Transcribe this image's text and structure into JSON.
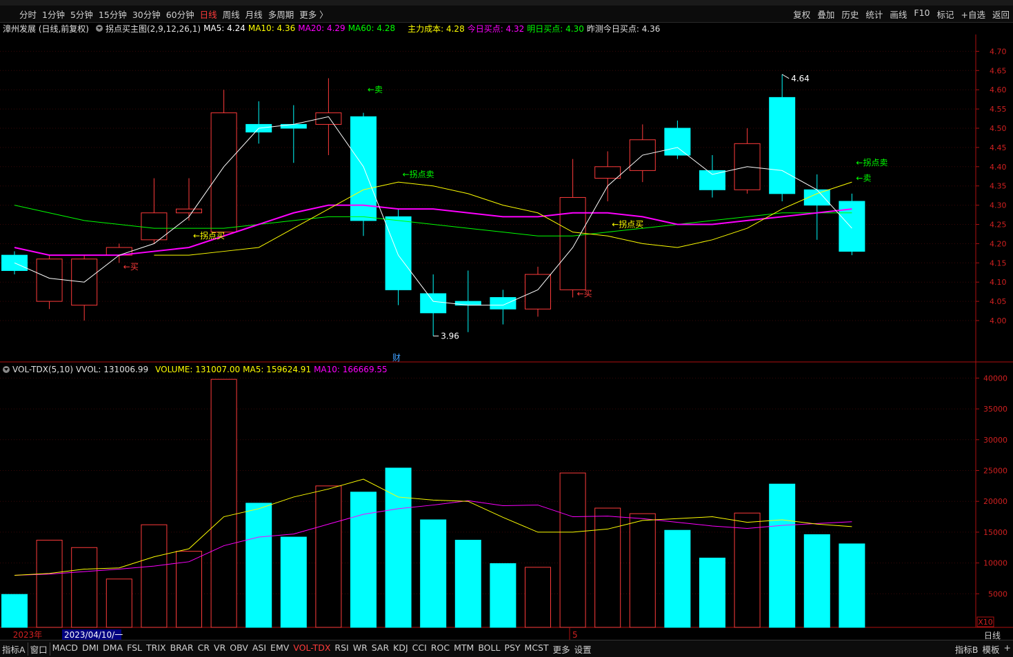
{
  "toolbar": {
    "periods": [
      "分时",
      "1分钟",
      "5分钟",
      "15分钟",
      "30分钟",
      "60分钟",
      "日线",
      "周线",
      "月线",
      "多周期",
      "更多 〉"
    ],
    "active_period": "日线",
    "actions": [
      "复权",
      "叠加",
      "历史",
      "统计",
      "画线",
      "F10",
      "标记",
      "+自选",
      "返回"
    ]
  },
  "main_indicator": {
    "stock": "漳州发展 (日线,前复权)",
    "formula": "拐点买主图(2,9,12,26,1)",
    "ma5": "MA5: 4.24",
    "ma10": "MA10: 4.36",
    "ma20": "MA20: 4.29",
    "ma60": "MA60: 4.28",
    "cost": "主力成本: 4.28",
    "today_buy": "今日买点: 4.32",
    "tomorrow_buy": "明日买点: 4.30",
    "yest_pred": "昨测今日买点: 4.36"
  },
  "vol_indicator": {
    "name": "VOL-TDX(5,10)",
    "vvol": "VVOL: 131006.99",
    "volume": "VOLUME: 131007.00",
    "ma5": "MA5: 159624.91",
    "ma10": "MA10: 166669.55"
  },
  "colors": {
    "up": "#ff3b3b",
    "down": "#00ffff",
    "ma5": "#ffffff",
    "ma10": "#ffff00",
    "ma20": "#ff00ff",
    "ma60": "#00ff00",
    "buy": "#ffff00",
    "sell": "#00ff00"
  },
  "chart_data": [
    {
      "type": "candlestick",
      "ylim": [
        4.0,
        4.7
      ],
      "y_ticks": [
        "4.70",
        "4.65",
        "4.60",
        "4.55",
        "4.50",
        "4.45",
        "4.40",
        "4.35",
        "4.30",
        "4.25",
        "4.20",
        "4.15",
        "4.10",
        "4.05",
        "4.00"
      ],
      "candles": [
        {
          "o": 4.17,
          "c": 4.13,
          "h": 4.18,
          "l": 4.12
        },
        {
          "o": 4.05,
          "c": 4.16,
          "h": 4.17,
          "l": 4.03
        },
        {
          "o": 4.04,
          "c": 4.16,
          "h": 4.17,
          "l": 4.0
        },
        {
          "o": 4.17,
          "c": 4.19,
          "h": 4.2,
          "l": 4.15
        },
        {
          "o": 4.21,
          "c": 4.28,
          "h": 4.37,
          "l": 4.2
        },
        {
          "o": 4.28,
          "c": 4.29,
          "h": 4.37,
          "l": 4.26
        },
        {
          "o": 4.23,
          "c": 4.54,
          "h": 4.6,
          "l": 4.22
        },
        {
          "o": 4.51,
          "c": 4.49,
          "h": 4.57,
          "l": 4.46
        },
        {
          "o": 4.51,
          "c": 4.5,
          "h": 4.56,
          "l": 4.41
        },
        {
          "o": 4.51,
          "c": 4.54,
          "h": 4.63,
          "l": 4.43
        },
        {
          "o": 4.53,
          "c": 4.26,
          "h": 4.54,
          "l": 4.22
        },
        {
          "o": 4.27,
          "c": 4.08,
          "h": 4.29,
          "l": 4.04
        },
        {
          "o": 4.07,
          "c": 4.02,
          "h": 4.12,
          "l": 3.96
        },
        {
          "o": 4.05,
          "c": 4.04,
          "h": 4.13,
          "l": 3.97
        },
        {
          "o": 4.06,
          "c": 4.03,
          "h": 4.08,
          "l": 3.99
        },
        {
          "o": 4.03,
          "c": 4.12,
          "h": 4.14,
          "l": 4.01
        },
        {
          "o": 4.08,
          "c": 4.32,
          "h": 4.42,
          "l": 4.06
        },
        {
          "o": 4.37,
          "c": 4.4,
          "h": 4.44,
          "l": 4.31
        },
        {
          "o": 4.39,
          "c": 4.47,
          "h": 4.51,
          "l": 4.36
        },
        {
          "o": 4.5,
          "c": 4.43,
          "h": 4.52,
          "l": 4.42
        },
        {
          "o": 4.39,
          "c": 4.34,
          "h": 4.43,
          "l": 4.32
        },
        {
          "o": 4.34,
          "c": 4.46,
          "h": 4.5,
          "l": 4.33
        },
        {
          "o": 4.58,
          "c": 4.33,
          "h": 4.64,
          "l": 4.31
        },
        {
          "o": 4.34,
          "c": 4.3,
          "h": 4.38,
          "l": 4.21
        },
        {
          "o": 4.31,
          "c": 4.18,
          "h": 4.33,
          "l": 4.17
        }
      ],
      "ma5": [
        4.15,
        4.11,
        4.1,
        4.17,
        4.2,
        4.27,
        4.4,
        4.5,
        4.51,
        4.53,
        4.4,
        4.17,
        4.05,
        4.04,
        4.04,
        4.08,
        4.19,
        4.35,
        4.43,
        4.45,
        4.38,
        4.4,
        4.39,
        4.34,
        4.24
      ],
      "ma10": [
        4.17,
        4.17,
        4.18,
        4.19,
        4.24,
        4.29,
        4.34,
        4.36,
        4.35,
        4.33,
        4.3,
        4.28,
        4.23,
        4.22,
        4.2,
        4.19,
        4.21,
        4.24,
        4.29,
        4.33,
        4.36
      ],
      "ma20": [
        4.19,
        4.17,
        4.17,
        4.17,
        4.18,
        4.19,
        4.22,
        4.25,
        4.28,
        4.3,
        4.3,
        4.29,
        4.29,
        4.28,
        4.27,
        4.27,
        4.28,
        4.28,
        4.27,
        4.25,
        4.25,
        4.26,
        4.27,
        4.28,
        4.29
      ],
      "ma60": [
        4.3,
        4.28,
        4.26,
        4.25,
        4.24,
        4.24,
        4.24,
        4.25,
        4.26,
        4.27,
        4.27,
        4.26,
        4.25,
        4.24,
        4.23,
        4.22,
        4.22,
        4.23,
        4.24,
        4.25,
        4.26,
        4.27,
        4.28,
        4.28,
        4.28
      ],
      "annotations": [
        {
          "text": "←卖",
          "type": "sell",
          "candle": 10,
          "price": 4.6
        },
        {
          "text": "←拐点卖",
          "type": "sell",
          "candle": 11,
          "price": 4.38
        },
        {
          "text": "←拐点买",
          "type": "buy",
          "candle": 5,
          "price": 4.22
        },
        {
          "text": "←买",
          "type": "buyred",
          "candle": 3,
          "price": 4.14
        },
        {
          "text": "←拐点买",
          "type": "buy",
          "candle": 17,
          "price": 4.25
        },
        {
          "text": "←买",
          "type": "buyred",
          "candle": 16,
          "price": 4.07
        },
        {
          "text": "←拐点卖",
          "type": "sell",
          "candle": 24,
          "price": 4.41
        },
        {
          "text": "←卖",
          "type": "sell",
          "candle": 24,
          "price": 4.37
        }
      ],
      "extremes": {
        "high": "4.64",
        "low": "3.96"
      },
      "finance_marker": "财"
    },
    {
      "type": "bar",
      "ylim": [
        0,
        42000
      ],
      "y_ticks": [
        "40000",
        "35000",
        "30000",
        "25000",
        "20000",
        "15000",
        "10000",
        "5000"
      ],
      "y_unit": "X10",
      "volumes": [
        4900,
        13700,
        12500,
        7400,
        16200,
        11900,
        39800,
        19700,
        14200,
        22500,
        21500,
        25400,
        17000,
        13700,
        9900,
        9300,
        24600,
        18900,
        18000,
        15300,
        10800,
        18100,
        22800,
        14600,
        13100
      ],
      "vol_ma5": [
        8000,
        8300,
        9000,
        9200,
        11000,
        12300,
        17500,
        18800,
        20700,
        22000,
        23600,
        20700,
        20200,
        20000,
        17400,
        15000,
        15000,
        15500,
        16900,
        17200,
        17500,
        16600,
        17000,
        16300,
        15900
      ],
      "vol_ma10": [
        8000,
        8200,
        8600,
        9000,
        9500,
        10200,
        12800,
        14200,
        14700,
        16300,
        17900,
        18800,
        19400,
        20100,
        19300,
        19400,
        17500,
        17600,
        17200,
        16600,
        16000,
        15600,
        16100,
        16400,
        16700
      ]
    }
  ],
  "date_axis": {
    "year": "2023年",
    "cursor_date": "2023/04/10/一",
    "month_mark": "5",
    "period": "日线"
  },
  "bottom_tabs": [
    "指标A",
    "窗口",
    "MACD",
    "DMI",
    "DMA",
    "FSL",
    "TRIX",
    "BRAR",
    "CR",
    "VR",
    "OBV",
    "ASI",
    "EMV",
    "VOL-TDX",
    "RSI",
    "WR",
    "SAR",
    "KDJ",
    "CCI",
    "ROC",
    "MTM",
    "BOLL",
    "PSY",
    "MCST",
    "更多",
    "设置"
  ],
  "active_tab": "VOL-TDX",
  "bottom_right": [
    "指标B",
    "模板",
    "+"
  ]
}
